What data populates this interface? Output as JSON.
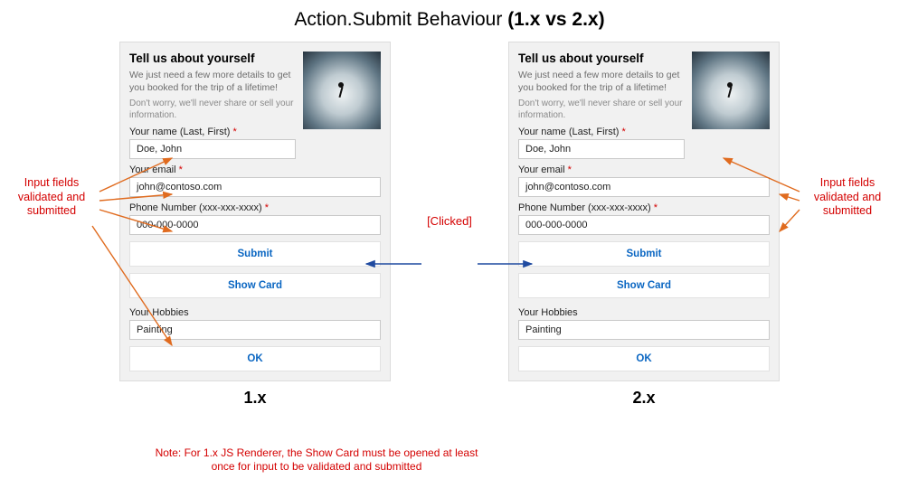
{
  "title_prefix": "Action.Submit Behaviour ",
  "title_bold": "(1.x vs 2.x)",
  "clicked_label": "[Clicked]",
  "anno_left": "Input fields validated and submitted",
  "anno_right": "Input fields validated and submitted",
  "note": "Note: For 1.x JS Renderer, the Show Card must be opened at least once for input to be validated and submitted",
  "versions": {
    "left": "1.x",
    "right": "2.x"
  },
  "card": {
    "title": "Tell us about yourself",
    "sub": "We just need a few more details to get you booked for the trip of a lifetime!",
    "sub2": "Don't worry, we'll never share or sell your information.",
    "fields": {
      "name_label": "Your name (Last, First)",
      "name_value": "Doe, John",
      "email_label": "Your email",
      "email_value": "john@contoso.com",
      "phone_label": "Phone Number (xxx-xxx-xxxx)",
      "phone_value": "000-000-0000",
      "hobbies_label": "Your Hobbies",
      "hobbies_value": "Painting"
    },
    "buttons": {
      "submit": "Submit",
      "showcard": "Show Card",
      "ok": "OK"
    },
    "required_marker": "*"
  }
}
